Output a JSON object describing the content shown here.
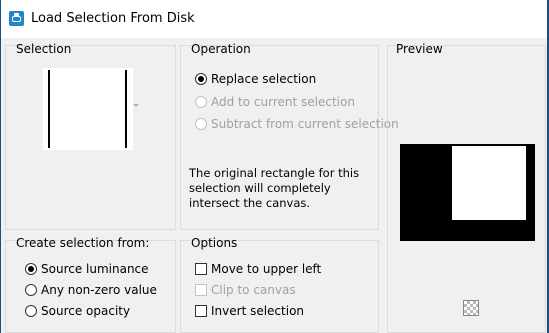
{
  "window": {
    "title": "Load Selection From Disk",
    "app_icon": "paint-app-icon"
  },
  "selection": {
    "label": "Selection"
  },
  "operation": {
    "label": "Operation",
    "options": [
      {
        "label": "Replace selection",
        "checked": true,
        "enabled": true
      },
      {
        "label": "Add to current selection",
        "checked": false,
        "enabled": false
      },
      {
        "label": "Subtract from current selection",
        "checked": false,
        "enabled": false
      }
    ],
    "info_text": "The original rectangle for this selection will completely intersect the canvas."
  },
  "preview": {
    "label": "Preview"
  },
  "create_from": {
    "label": "Create selection from:",
    "options": [
      {
        "label": "Source luminance",
        "checked": true
      },
      {
        "label": "Any non-zero value",
        "checked": false
      },
      {
        "label": "Source opacity",
        "checked": false
      }
    ]
  },
  "options": {
    "label": "Options",
    "items": [
      {
        "label": "Move to upper left",
        "checked": false,
        "enabled": true
      },
      {
        "label": "Clip to canvas",
        "checked": false,
        "enabled": false
      },
      {
        "label": "Invert selection",
        "checked": false,
        "enabled": true
      }
    ]
  },
  "colors": {
    "titlebar": "#ffffff",
    "dialog_bg": "#f0f0f0",
    "border": "#1c4f86",
    "app_icon": "#1e88c8"
  }
}
